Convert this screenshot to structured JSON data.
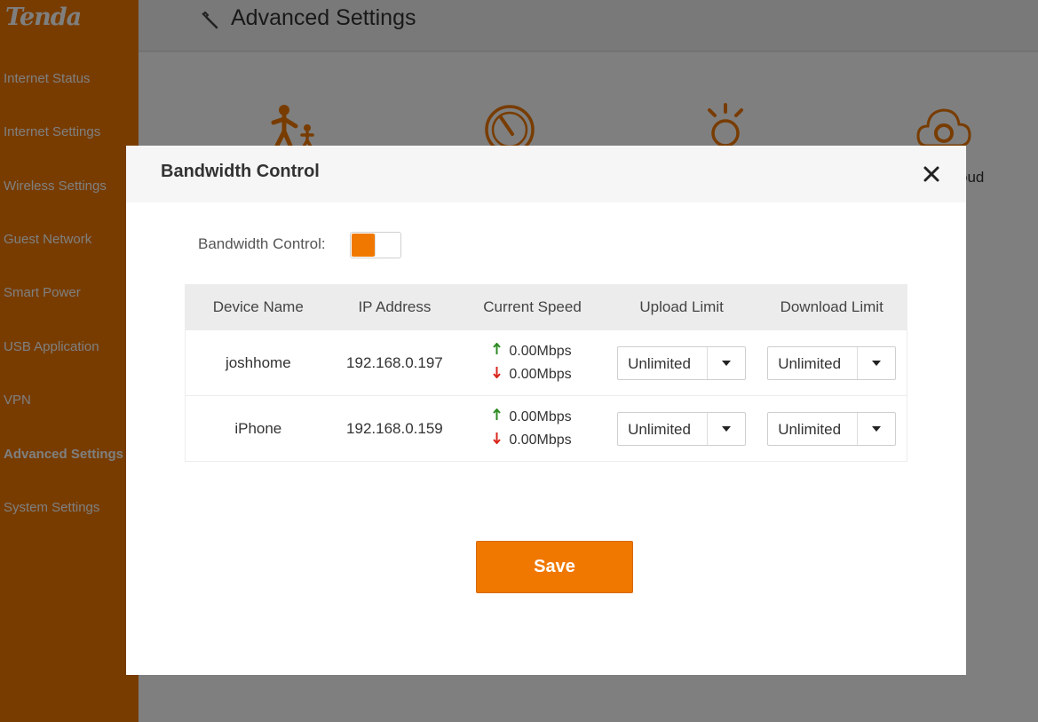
{
  "brand": {
    "logo_text": "Tenda",
    "accent_color": "#f07800"
  },
  "sidebar": {
    "items": [
      {
        "label": "Internet Status",
        "active": false
      },
      {
        "label": "Internet Settings",
        "active": false
      },
      {
        "label": "Wireless Settings",
        "active": false
      },
      {
        "label": "Guest Network",
        "active": false
      },
      {
        "label": "Smart Power",
        "active": false
      },
      {
        "label": "USB Application",
        "active": false
      },
      {
        "label": "VPN",
        "active": false
      },
      {
        "label": "Advanced Settings",
        "active": true
      },
      {
        "label": "System Settings",
        "active": false
      }
    ]
  },
  "header": {
    "title": "Advanced Settings",
    "icon": "wrench-icon"
  },
  "features": {
    "icons": [
      "parental-control-icon",
      "speed-gauge-icon",
      "led-bulb-icon",
      "cloud-gear-icon"
    ],
    "partial_label": "oud"
  },
  "dialog": {
    "title": "Bandwidth Control",
    "close_icon": "close-icon",
    "bandwidth_control": {
      "label": "Bandwidth Control:",
      "enabled": true
    },
    "table": {
      "headers": [
        "Device Name",
        "IP Address",
        "Current Speed",
        "Upload Limit",
        "Download Limit"
      ],
      "rows": [
        {
          "device": "joshhome",
          "ip": "192.168.0.197",
          "up_speed": "0.00Mbps",
          "down_speed": "0.00Mbps",
          "upload_limit": "Unlimited",
          "download_limit": "Unlimited"
        },
        {
          "device": "iPhone",
          "ip": "192.168.0.159",
          "up_speed": "0.00Mbps",
          "down_speed": "0.00Mbps",
          "upload_limit": "Unlimited",
          "download_limit": "Unlimited"
        }
      ]
    },
    "save_label": "Save"
  },
  "colors": {
    "upload_arrow": "#2e8b22",
    "download_arrow": "#d9261c",
    "sidebar_bg": "#f07800"
  }
}
